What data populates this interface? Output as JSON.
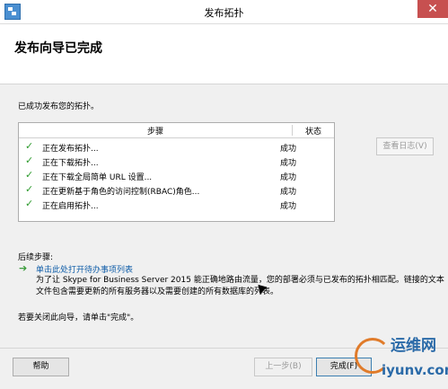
{
  "window": {
    "title": "发布拓扑",
    "close_label": "✕"
  },
  "header": {
    "title": "发布向导已完成"
  },
  "intro": "已成功发布您的拓扑。",
  "table": {
    "col_step": "步骤",
    "col_status": "状态",
    "rows": [
      {
        "step": "正在发布拓扑...",
        "status": "成功"
      },
      {
        "step": "正在下载拓扑...",
        "status": "成功"
      },
      {
        "step": "正在下载全局简单 URL 设置...",
        "status": "成功"
      },
      {
        "step": "正在更新基于角色的访问控制(RBAC)角色...",
        "status": "成功"
      },
      {
        "step": "正在启用拓扑...",
        "status": "成功"
      }
    ]
  },
  "view_log_label": "查看日志(V)",
  "next_steps": {
    "title": "后续步骤:",
    "link": "单击此处打开待办事项列表",
    "description": "为了让 Skype for Business Server 2015 能正确地路由流量，您的部署必须与已发布的拓扑相匹配。链接的文本文件包含需要更新的所有服务器以及需要创建的所有数据库的列表。"
  },
  "close_hint": "若要关闭此向导，请单击\"完成\"。",
  "buttons": {
    "help": "帮助",
    "prev": "上一步(B)",
    "finish": "完成(F)"
  },
  "watermark": {
    "line1": "运维网",
    "line2": "iyunv.com"
  },
  "colors": {
    "accent": "#0f5da8",
    "success": "#2e9b2e",
    "close": "#c75050"
  }
}
